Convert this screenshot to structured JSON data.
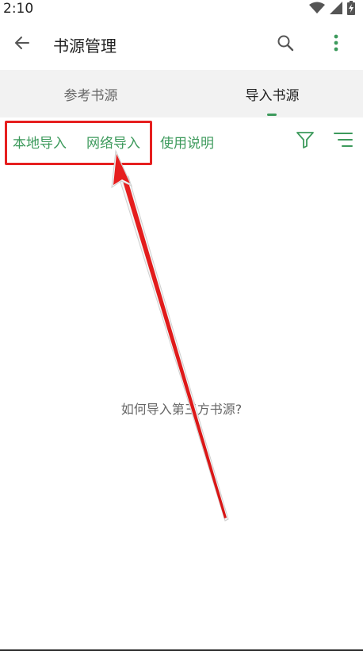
{
  "status_bar": {
    "time": "2:10",
    "icons": [
      "wifi-icon",
      "signal-icon",
      "battery-icon"
    ]
  },
  "app_bar": {
    "title": "书源管理",
    "back_icon": "arrow-left-icon",
    "search_icon": "search-icon",
    "more_icon": "more-vertical-icon"
  },
  "tabs": [
    {
      "label": "参考书源",
      "selected": false
    },
    {
      "label": "导入书源",
      "selected": true
    }
  ],
  "toolbar": {
    "local_import": "本地导入",
    "network_import": "网络导入",
    "usage_guide": "使用说明",
    "filter_icon": "filter-icon",
    "sort_icon": "sort-lines-icon"
  },
  "empty_state": {
    "hint": "如何导入第三方书源?"
  },
  "colors": {
    "accent": "#3d9a5c",
    "annotation": "#e61f1f",
    "tab_bg": "#f2f2f2"
  }
}
